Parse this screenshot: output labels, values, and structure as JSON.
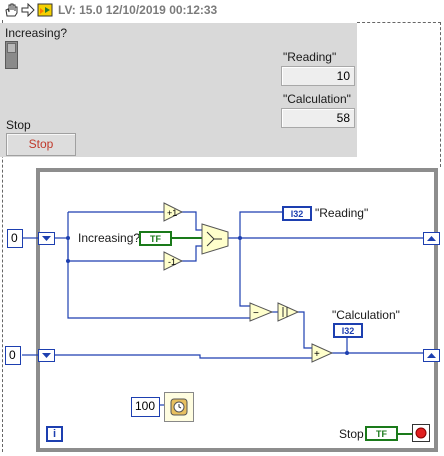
{
  "toolbar": {
    "hand_icon": "hand-icon",
    "arrow_icon": "run-arrow-icon",
    "lv_icon": "labview-icon",
    "title": "LV: 15.0 12/10/2019 00:12:33"
  },
  "front_panel": {
    "increasing_label": "Increasing?",
    "reading_label": "\"Reading\"",
    "reading_value": "10",
    "calculation_label": "\"Calculation\"",
    "calculation_value": "58",
    "stop_label": "Stop",
    "stop_button": "Stop"
  },
  "diagram": {
    "const_top": "0",
    "const_bottom": "0",
    "const_wait": "100",
    "increasing_label": "Increasing?",
    "increasing_type": "TF",
    "reading_type": "I32",
    "reading_label": "\"Reading\"",
    "calculation_label": "\"Calculation\"",
    "calculation_type": "I32",
    "increment_glyph": "+1",
    "decrement_glyph": "-1",
    "subtract_glyph": "−",
    "add_glyph": "+",
    "stop_label": "Stop",
    "stop_type": "TF",
    "iteration_glyph": "i"
  },
  "colors": {
    "wire_blue": "#1d3fb0",
    "wire_green": "#1a7a1a",
    "node_yellow": "#ffffcc",
    "panel_gray": "#d9d9d9"
  }
}
